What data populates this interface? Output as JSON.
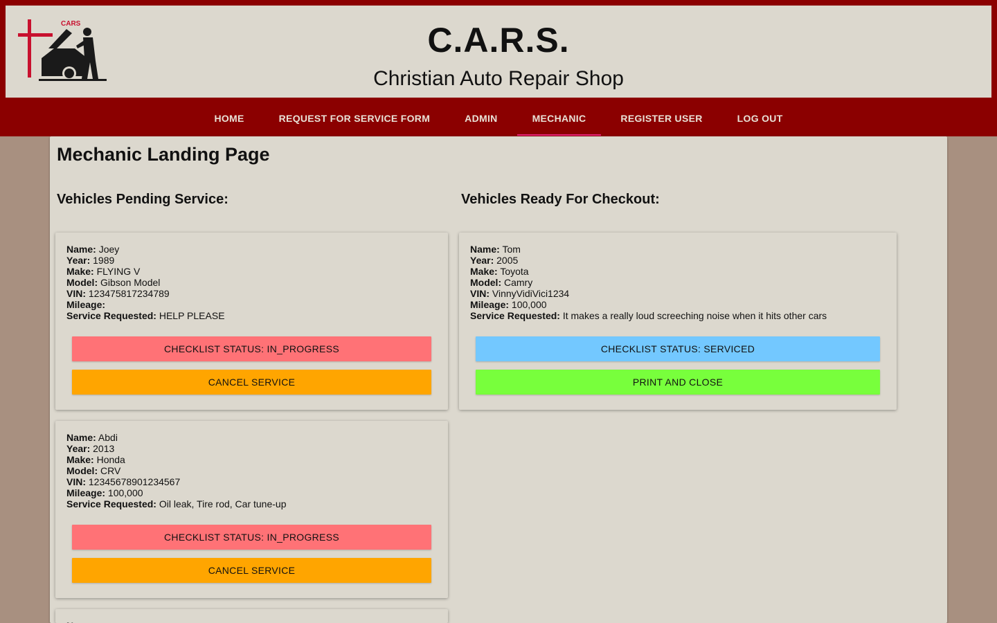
{
  "header": {
    "logo_text": "CARS",
    "logo_side_text": "Christian Auto Repair Shop",
    "title": "C.A.R.S.",
    "subtitle": "Christian Auto Repair Shop",
    "colors": {
      "bar": "#8b0000",
      "banner": "#dcd8ce",
      "cross": "#c8102e"
    }
  },
  "nav": {
    "items": [
      {
        "label": "HOME"
      },
      {
        "label": "REQUEST FOR SERVICE FORM"
      },
      {
        "label": "ADMIN"
      },
      {
        "label": "MECHANIC",
        "active": true
      },
      {
        "label": "REGISTER USER"
      },
      {
        "label": "LOG OUT"
      }
    ],
    "active_color": "#e8257a"
  },
  "page": {
    "title": "Mechanic Landing Page",
    "pending_title": "Vehicles Pending Service:",
    "ready_title": "Vehicles Ready For Checkout:"
  },
  "labels": {
    "name": "Name:",
    "year": "Year:",
    "make": "Make:",
    "model": "Model:",
    "vin": "VIN:",
    "mileage": "Mileage:",
    "service": "Service Requested:"
  },
  "pending": [
    {
      "name": "Joey",
      "year": "1989",
      "make": "FLYING V",
      "model": "Gibson Model",
      "vin": "123475817234789",
      "mileage": "",
      "service": "HELP PLEASE",
      "status_button": "CHECKLIST STATUS: IN_PROGRESS",
      "action_button": "CANCEL SERVICE"
    },
    {
      "name": "Abdi",
      "year": "2013",
      "make": "Honda",
      "model": "CRV",
      "vin": "12345678901234567",
      "mileage": "100,000",
      "service": "Oil leak, Tire rod, Car tune-up",
      "status_button": "CHECKLIST STATUS: IN_PROGRESS",
      "action_button": "CANCEL SERVICE"
    },
    {
      "name": "",
      "year": "",
      "make": "",
      "model": "",
      "vin": "",
      "mileage": "",
      "service": "",
      "status_button": "",
      "action_button": ""
    }
  ],
  "ready": [
    {
      "name": "Tom",
      "year": "2005",
      "make": "Toyota",
      "model": "Camry",
      "vin": "VinnyVidiVici1234",
      "mileage": "100,000",
      "service": "It makes a really loud screeching noise when it hits other cars",
      "status_button": "CHECKLIST STATUS: SERVICED",
      "action_button": "PRINT AND CLOSE"
    }
  ],
  "colors": {
    "background": "#a89080",
    "in_progress": "#ff7276",
    "cancel": "#ffa500",
    "serviced": "#73c8ff",
    "print_close": "#78ff3c"
  }
}
